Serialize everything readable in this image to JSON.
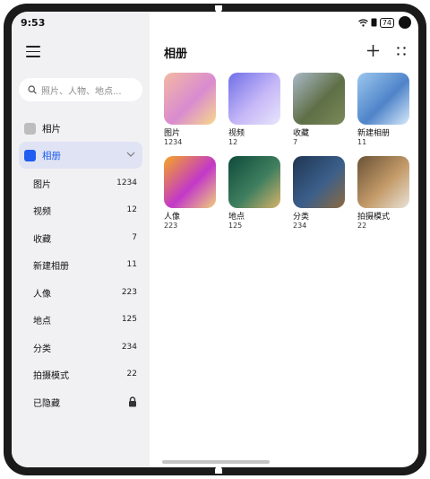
{
  "status": {
    "time": "9:53",
    "battery": "74"
  },
  "sidebar": {
    "search_placeholder": "照片、人物、地点...",
    "top_item": "相片",
    "albums_item": "相册",
    "sub_items": [
      {
        "label": "图片",
        "count": "1234"
      },
      {
        "label": "视频",
        "count": "12"
      },
      {
        "label": "收藏",
        "count": "7"
      },
      {
        "label": "新建相册",
        "count": "11"
      },
      {
        "label": "人像",
        "count": "223"
      },
      {
        "label": "地点",
        "count": "125"
      },
      {
        "label": "分类",
        "count": "234"
      },
      {
        "label": "拍摄模式",
        "count": "22"
      },
      {
        "label": "已隐藏",
        "count": ""
      }
    ]
  },
  "main": {
    "title": "相册",
    "albums": [
      {
        "name": "图片",
        "count": "1234",
        "colors": [
          "#f3b9a2",
          "#d98bd0",
          "#f7d98a"
        ]
      },
      {
        "name": "视频",
        "count": "12",
        "colors": [
          "#6f6fe8",
          "#c6b7f7",
          "#e6e6fb"
        ]
      },
      {
        "name": "收藏",
        "count": "7",
        "colors": [
          "#a9b9c7",
          "#5f6f47",
          "#7a8a58"
        ]
      },
      {
        "name": "新建相册",
        "count": "11",
        "colors": [
          "#9cc7ee",
          "#4f84c9",
          "#d8eafa"
        ]
      },
      {
        "name": "人像",
        "count": "223",
        "colors": [
          "#f5a623",
          "#c238c9",
          "#f0d07a"
        ]
      },
      {
        "name": "地点",
        "count": "125",
        "colors": [
          "#0f4a3b",
          "#3f7f5f",
          "#d6b36a"
        ]
      },
      {
        "name": "分类",
        "count": "234",
        "colors": [
          "#1f3552",
          "#3b5f8a",
          "#8c6a3f"
        ]
      },
      {
        "name": "拍摄模式",
        "count": "22",
        "colors": [
          "#6a5236",
          "#c39a68",
          "#e8e3d8"
        ]
      }
    ]
  }
}
